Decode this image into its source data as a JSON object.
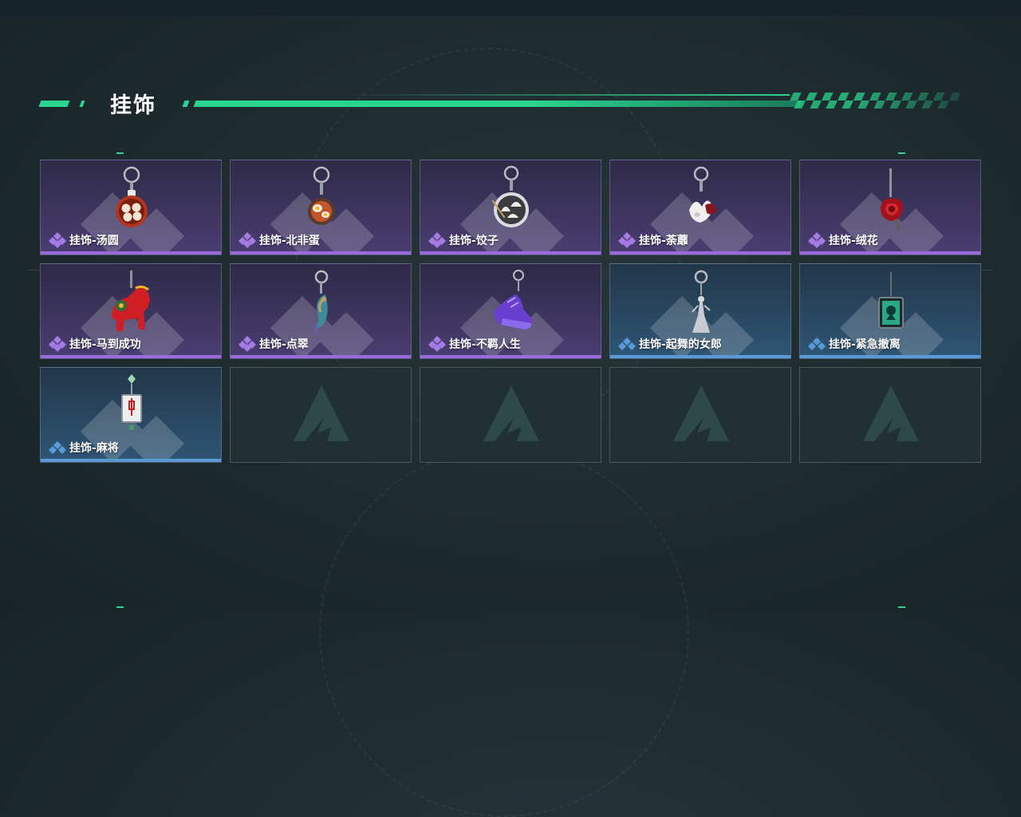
{
  "section": {
    "title": "挂饰"
  },
  "colors": {
    "accent": "#2bd58f",
    "rare_purple": "#9a6bdc",
    "rare_blue": "#5a9ad8"
  },
  "items": [
    {
      "label": "挂饰-汤圆",
      "rarity": "purple",
      "icon": "tangyuan-charm-icon"
    },
    {
      "label": "挂饰-北非蛋",
      "rarity": "purple",
      "icon": "shakshuka-charm-icon"
    },
    {
      "label": "挂饰-饺子",
      "rarity": "purple",
      "icon": "dumpling-charm-icon"
    },
    {
      "label": "挂饰-荼蘼",
      "rarity": "purple",
      "icon": "flower-charm-icon"
    },
    {
      "label": "挂饰-绒花",
      "rarity": "purple",
      "icon": "rose-charm-icon"
    },
    {
      "label": "挂饰-马到成功",
      "rarity": "purple",
      "icon": "horse-charm-icon"
    },
    {
      "label": "挂饰-点翠",
      "rarity": "purple",
      "icon": "kingfisher-charm-icon"
    },
    {
      "label": "挂饰-不羁人生",
      "rarity": "purple",
      "icon": "sneaker-charm-icon"
    },
    {
      "label": "挂饰-起舞的女郎",
      "rarity": "blue",
      "icon": "dancer-charm-icon"
    },
    {
      "label": "挂饰-紧急撤离",
      "rarity": "blue",
      "icon": "emergency-tag-charm-icon"
    },
    {
      "label": "挂饰-麻将",
      "rarity": "blue",
      "icon": "mahjong-charm-icon"
    }
  ],
  "empty_slots": 4
}
